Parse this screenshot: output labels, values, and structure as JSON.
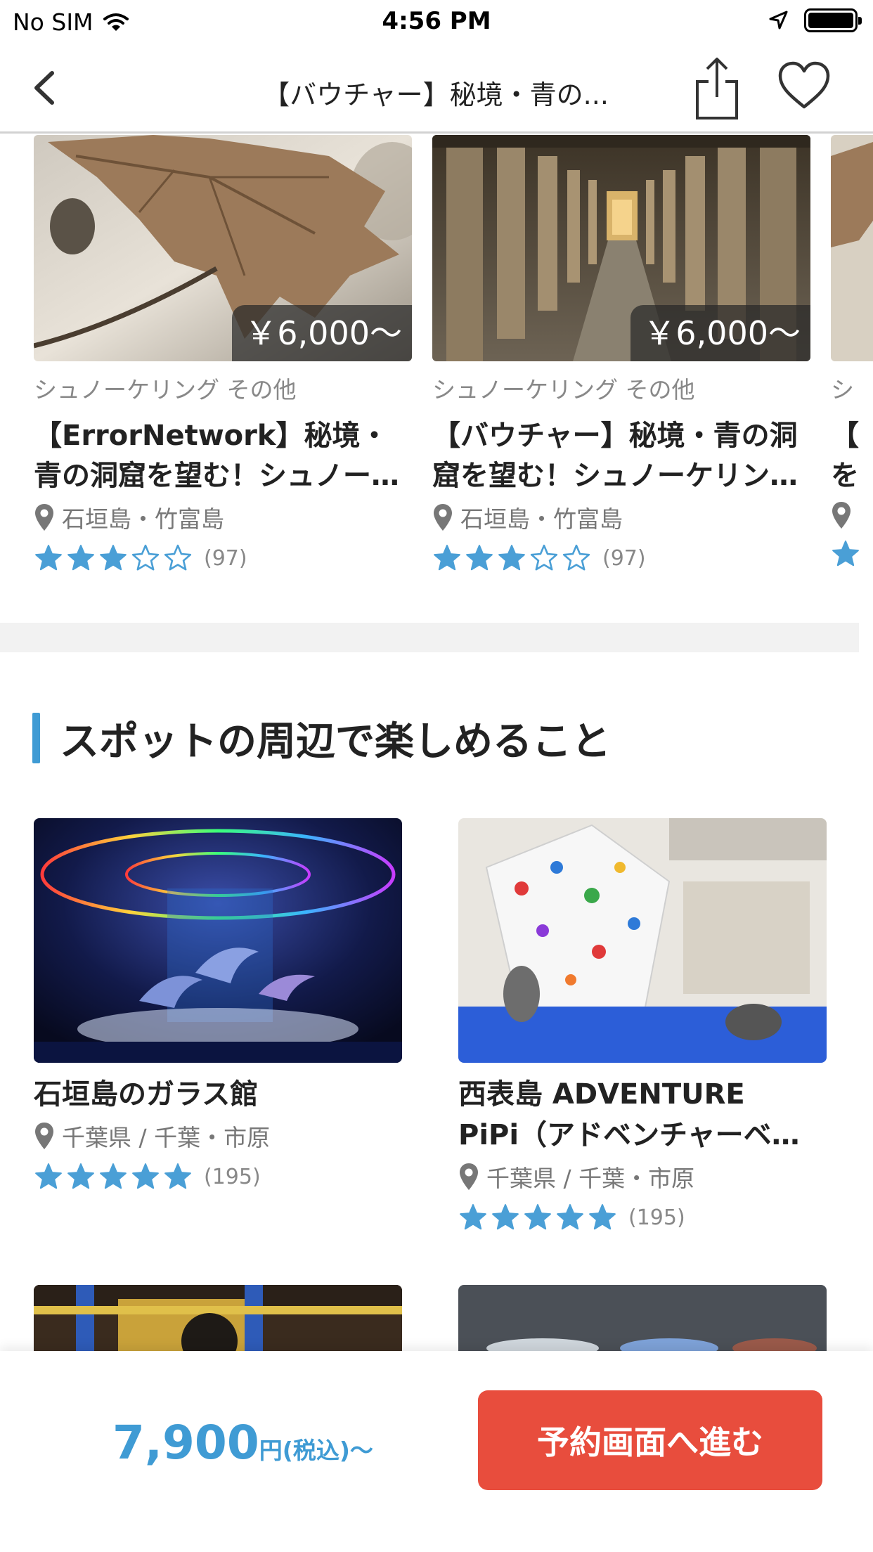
{
  "status_bar": {
    "carrier": "No SIM",
    "time": "4:56 PM"
  },
  "nav": {
    "title": "【バウチャー】秘境・青の..."
  },
  "carousel": {
    "cards": [
      {
        "price": "￥6,000〜",
        "category": "シュノーケリング その他",
        "title_lines": [
          "【ErrorNetwork】秘境・",
          "青の洞窟を望む！シュノー…"
        ],
        "location": "石垣島・竹富島",
        "rating": 3,
        "review_count": "(97)"
      },
      {
        "price": "￥6,000〜",
        "category": "シュノーケリング その他",
        "title_lines": [
          "【バウチャー】秘境・青の洞",
          "窟を望む！シュノーケリン…"
        ],
        "location": "石垣島・竹富島",
        "rating": 3,
        "review_count": "(97)"
      },
      {
        "category": "シ",
        "title_lines": [
          "【",
          "を"
        ]
      }
    ]
  },
  "section": {
    "heading": "スポットの周辺で楽しめること"
  },
  "spots": [
    {
      "name_lines": [
        "石垣島のガラス館"
      ],
      "location": "千葉県 / 千葉・市原",
      "rating": 5,
      "review_count": "(195)"
    },
    {
      "name_lines": [
        "西表島 ADVENTURE",
        "PiPi（アドベンチャーベ…"
      ],
      "location": "千葉県 / 千葉・市原",
      "rating": 5,
      "review_count": "(195)"
    }
  ],
  "bottom_bar": {
    "price_value": "7,900",
    "price_unit": "円(税込)〜",
    "reserve_button": "予約画面へ進む"
  },
  "colors": {
    "accent_blue": "#3f9bd4",
    "star_blue": "#4a9fd6",
    "reserve_red": "#e84d3d"
  }
}
